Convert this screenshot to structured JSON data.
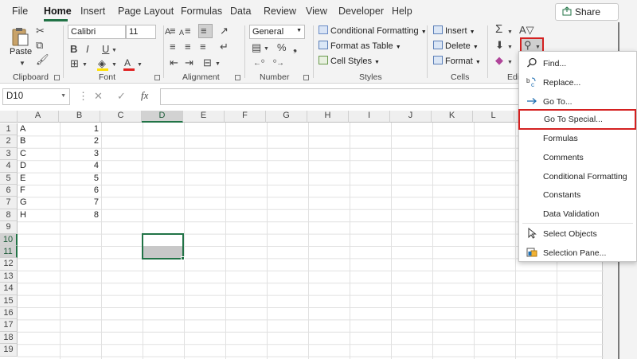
{
  "menu_tabs": [
    "File",
    "Home",
    "Insert",
    "Page Layout",
    "Formulas",
    "Data",
    "Review",
    "View",
    "Developer",
    "Help"
  ],
  "share_label": "Share",
  "ribbon": {
    "groups": {
      "clipboard": "Clipboard",
      "font": "Font",
      "alignment": "Alignment",
      "number": "Number",
      "styles": "Styles",
      "cells": "Cells",
      "editing": "Editi"
    },
    "paste_label": "Paste",
    "font_name": "Calibri",
    "font_size": "11",
    "number_format": "General",
    "conditional_formatting": "Conditional Formatting",
    "format_as_table": "Format as Table",
    "cell_styles": "Cell Styles",
    "insert": "Insert",
    "delete": "Delete",
    "format": "Format",
    "percent_symbol": "%",
    "fx_symbol": "fx"
  },
  "formula_bar": {
    "name_box": "D10",
    "formula": ""
  },
  "grid": {
    "columns": [
      "A",
      "B",
      "C",
      "D",
      "E",
      "F",
      "G",
      "H",
      "I",
      "J",
      "K",
      "L"
    ],
    "rows": [
      "1",
      "2",
      "3",
      "4",
      "5",
      "6",
      "7",
      "8",
      "9",
      "10",
      "11",
      "12",
      "13",
      "14",
      "15",
      "16",
      "17",
      "18",
      "19"
    ],
    "col_a": [
      "A",
      "B",
      "C",
      "D",
      "E",
      "F",
      "G",
      "H"
    ],
    "col_b": [
      "1",
      "2",
      "3",
      "4",
      "5",
      "6",
      "7",
      "8"
    ],
    "selected_cell": "D10"
  },
  "find_select_menu": {
    "items": [
      "Find...",
      "Replace...",
      "Go To...",
      "Go To Special...",
      "Formulas",
      "Comments",
      "Conditional Formatting",
      "Constants",
      "Data Validation",
      "Select Objects",
      "Selection Pane..."
    ],
    "highlighted_item": "Go To Special..."
  },
  "colors": {
    "accent": "#217346",
    "highlight_border": "#d42020",
    "font_color_bar": "#e02020",
    "fill_color_bar": "#ffe000",
    "selected_header": "#d2d2d2"
  }
}
